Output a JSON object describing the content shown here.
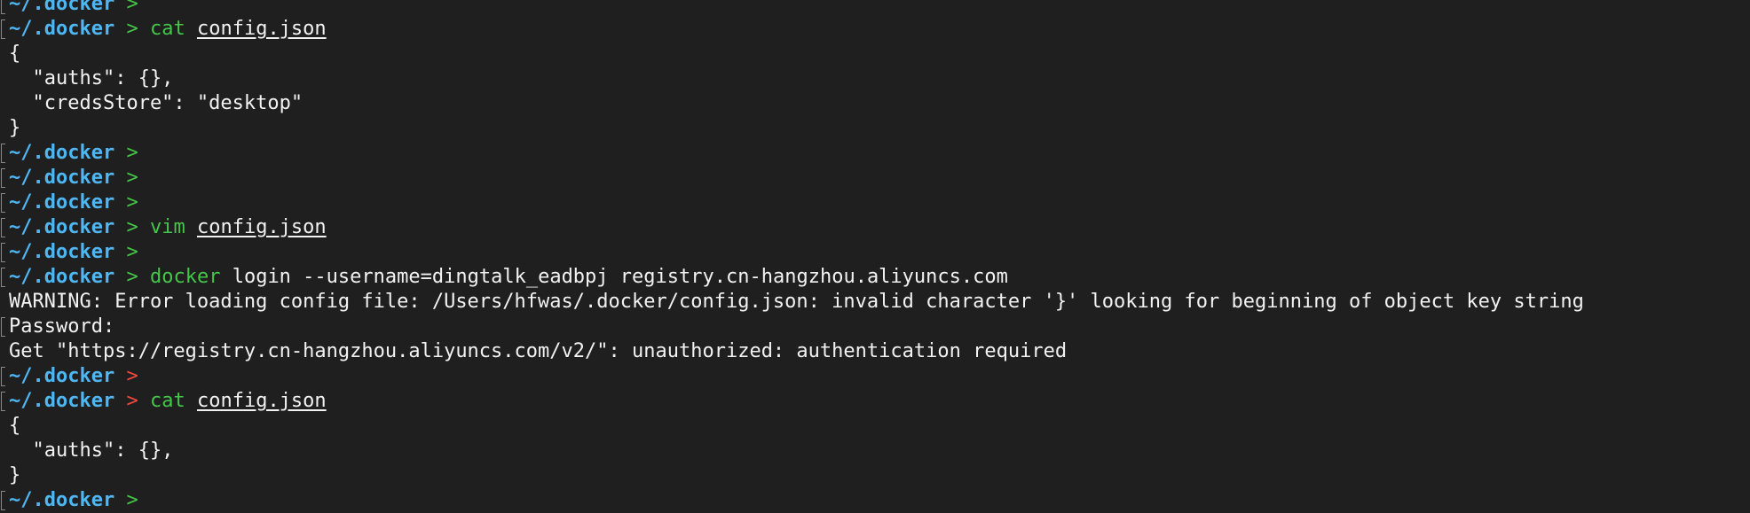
{
  "terminal": {
    "lines": [
      {
        "type": "prompt",
        "dir": "~/.docker",
        "arrow": ">",
        "status": "ok",
        "cmd": "",
        "rest": ""
      },
      {
        "type": "prompt",
        "dir": "~/.docker",
        "arrow": ">",
        "status": "ok",
        "cmd": "cat",
        "rest": "config.json",
        "rest_underline": true
      },
      {
        "type": "output",
        "text": "{"
      },
      {
        "type": "output",
        "text": "  \"auths\": {},"
      },
      {
        "type": "output",
        "text": "  \"credsStore\": \"desktop\""
      },
      {
        "type": "output",
        "text": "}"
      },
      {
        "type": "prompt",
        "dir": "~/.docker",
        "arrow": ">",
        "status": "ok",
        "cmd": "",
        "rest": ""
      },
      {
        "type": "prompt",
        "dir": "~/.docker",
        "arrow": ">",
        "status": "ok",
        "cmd": "",
        "rest": ""
      },
      {
        "type": "prompt",
        "dir": "~/.docker",
        "arrow": ">",
        "status": "ok",
        "cmd": "",
        "rest": ""
      },
      {
        "type": "prompt",
        "dir": "~/.docker",
        "arrow": ">",
        "status": "ok",
        "cmd": "vim",
        "rest": "config.json",
        "rest_underline": true
      },
      {
        "type": "prompt",
        "dir": "~/.docker",
        "arrow": ">",
        "status": "ok",
        "cmd": "",
        "rest": ""
      },
      {
        "type": "prompt",
        "dir": "~/.docker",
        "arrow": ">",
        "status": "ok",
        "cmd": "docker",
        "rest": "login --username=dingtalk_eadbpj registry.cn-hangzhou.aliyuncs.com",
        "rest_underline": false
      },
      {
        "type": "output",
        "text": "WARNING: Error loading config file: /Users/hfwas/.docker/config.json: invalid character '}' looking for beginning of object key string"
      },
      {
        "type": "output",
        "text": "Password:",
        "bracket": true
      },
      {
        "type": "output",
        "text": "Get \"https://registry.cn-hangzhou.aliyuncs.com/v2/\": unauthorized: authentication required"
      },
      {
        "type": "prompt",
        "dir": "~/.docker",
        "arrow": ">",
        "status": "err",
        "cmd": "",
        "rest": ""
      },
      {
        "type": "prompt",
        "dir": "~/.docker",
        "arrow": ">",
        "status": "err",
        "cmd": "cat",
        "rest": "config.json",
        "rest_underline": true
      },
      {
        "type": "output",
        "text": "{"
      },
      {
        "type": "output",
        "text": "  \"auths\": {},"
      },
      {
        "type": "output",
        "text": "}"
      },
      {
        "type": "prompt",
        "dir": "~/.docker",
        "arrow": ">",
        "status": "ok",
        "cmd": "",
        "rest": ""
      }
    ]
  },
  "colors": {
    "background": "#1f1f1f",
    "text": "#f2f2f2",
    "directory": "#4fb6f2",
    "arrow_ok": "#45c64a",
    "arrow_error": "#ef4a3e",
    "command": "#45c64a"
  }
}
